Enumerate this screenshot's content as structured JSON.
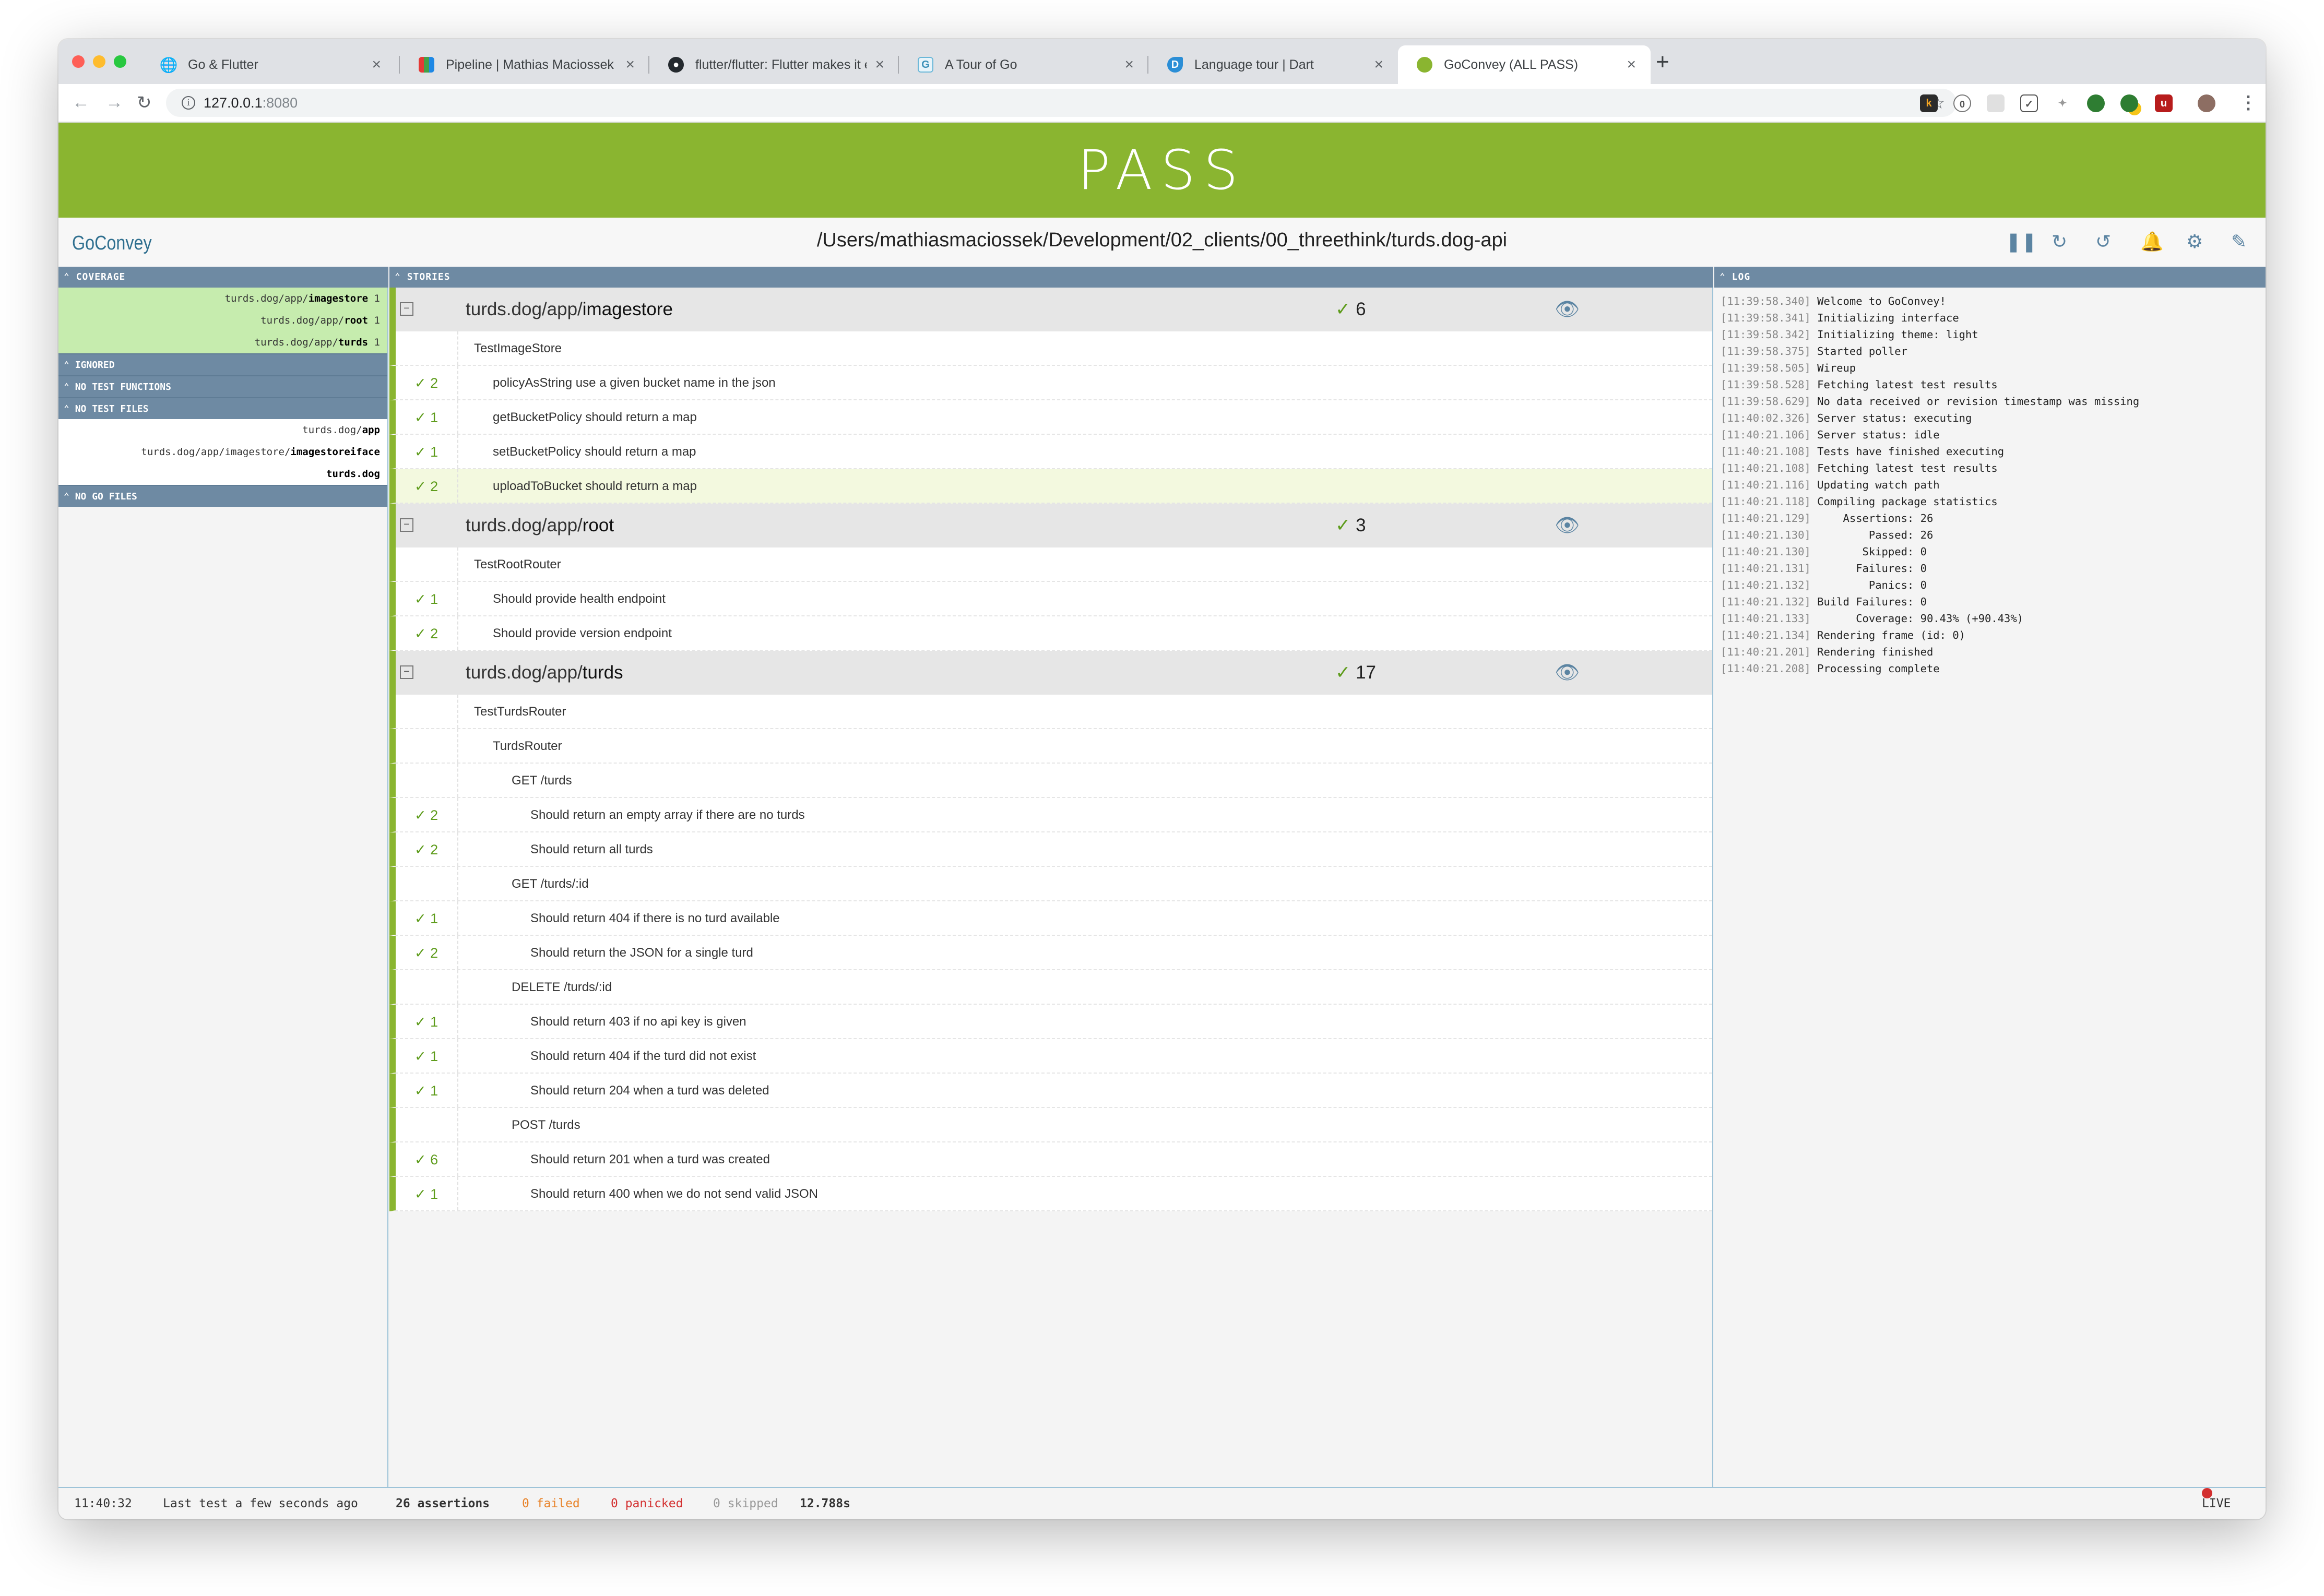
{
  "browser": {
    "tabs": [
      {
        "title": "Go & Flutter",
        "icon": "globe-icon"
      },
      {
        "title": "Pipeline | Mathias Maciossek CR",
        "icon": "pipeline-icon"
      },
      {
        "title": "flutter/flutter: Flutter makes it ea",
        "icon": "github-icon"
      },
      {
        "title": "A Tour of Go",
        "icon": "gopher-icon"
      },
      {
        "title": "Language tour | Dart",
        "icon": "dart-icon"
      },
      {
        "title": "GoConvey (ALL PASS)",
        "icon": "goconvey-icon"
      }
    ],
    "url_host": "127.0.0.1",
    "url_port": ":8080"
  },
  "banner": {
    "text": "PASS",
    "color": "#8ab530"
  },
  "header": {
    "brand": "GoConvey",
    "path": "/Users/mathiasmaciossek/Development/02_clients/00_threethink/turds.dog-api"
  },
  "coverage": {
    "title": "COVERAGE",
    "items": [
      {
        "prefix": "turds.dog/app/",
        "pkg": "imagestore",
        "pct": "1"
      },
      {
        "prefix": "turds.dog/app/",
        "pkg": "root",
        "pct": "1"
      },
      {
        "prefix": "turds.dog/app/",
        "pkg": "turds",
        "pct": "1"
      }
    ],
    "ignored": "IGNORED",
    "no_test_functions": "NO TEST FUNCTIONS",
    "no_test_files": "NO TEST FILES",
    "no_test_files_items": [
      {
        "prefix": "turds.dog/",
        "bold": "app"
      },
      {
        "prefix": "turds.dog/app/imagestore/",
        "bold": "imagestoreiface"
      },
      {
        "prefix": "",
        "bold": "turds.dog"
      }
    ],
    "no_go_files": "NO GO FILES"
  },
  "stories": {
    "title": "STORIES",
    "packages": [
      {
        "prefix": "turds.dog/app/",
        "name": "imagestore",
        "count": "6",
        "rows": [
          {
            "count": "",
            "text": "TestImageStore",
            "level": 0,
            "hl": false
          },
          {
            "count": "2",
            "text": "policyAsString use a given bucket name in the json",
            "level": 1,
            "hl": false
          },
          {
            "count": "1",
            "text": "getBucketPolicy should return a map",
            "level": 1,
            "hl": false
          },
          {
            "count": "1",
            "text": "setBucketPolicy should return a map",
            "level": 1,
            "hl": false
          },
          {
            "count": "2",
            "text": "uploadToBucket should return a map",
            "level": 1,
            "hl": true
          }
        ]
      },
      {
        "prefix": "turds.dog/app/",
        "name": "root",
        "count": "3",
        "rows": [
          {
            "count": "",
            "text": "TestRootRouter",
            "level": 0,
            "hl": false
          },
          {
            "count": "1",
            "text": "Should provide health endpoint",
            "level": 1,
            "hl": false
          },
          {
            "count": "2",
            "text": "Should provide version endpoint",
            "level": 1,
            "hl": false
          }
        ]
      },
      {
        "prefix": "turds.dog/app/",
        "name": "turds",
        "count": "17",
        "rows": [
          {
            "count": "",
            "text": "TestTurdsRouter",
            "level": 0,
            "hl": false
          },
          {
            "count": "",
            "text": "TurdsRouter",
            "level": 1,
            "hl": false
          },
          {
            "count": "",
            "text": "GET /turds",
            "level": 2,
            "hl": false
          },
          {
            "count": "2",
            "text": "Should return an empty array if there are no turds",
            "level": 3,
            "hl": false
          },
          {
            "count": "2",
            "text": "Should return all turds",
            "level": 3,
            "hl": false
          },
          {
            "count": "",
            "text": "GET /turds/:id",
            "level": 2,
            "hl": false
          },
          {
            "count": "1",
            "text": "Should return 404 if there is no turd available",
            "level": 3,
            "hl": false
          },
          {
            "count": "2",
            "text": "Should return the JSON for a single turd",
            "level": 3,
            "hl": false
          },
          {
            "count": "",
            "text": "DELETE /turds/:id",
            "level": 2,
            "hl": false
          },
          {
            "count": "1",
            "text": "Should return 403 if no api key is given",
            "level": 3,
            "hl": false
          },
          {
            "count": "1",
            "text": "Should return 404 if the turd did not exist",
            "level": 3,
            "hl": false
          },
          {
            "count": "1",
            "text": "Should return 204 when a turd was deleted",
            "level": 3,
            "hl": false
          },
          {
            "count": "",
            "text": "POST /turds",
            "level": 2,
            "hl": false
          },
          {
            "count": "6",
            "text": "Should return 201 when a turd was created",
            "level": 3,
            "hl": false
          },
          {
            "count": "1",
            "text": "Should return 400 when we do not send valid JSON",
            "level": 3,
            "hl": false
          }
        ]
      }
    ]
  },
  "log": {
    "title": "LOG",
    "lines": [
      {
        "ts": "[11:39:58.340]",
        "msg": "Welcome to GoConvey!"
      },
      {
        "ts": "[11:39:58.341]",
        "msg": "Initializing interface"
      },
      {
        "ts": "[11:39:58.342]",
        "msg": "Initializing theme: light"
      },
      {
        "ts": "[11:39:58.375]",
        "msg": "Started poller"
      },
      {
        "ts": "[11:39:58.505]",
        "msg": "Wireup"
      },
      {
        "ts": "[11:39:58.528]",
        "msg": "Fetching latest test results"
      },
      {
        "ts": "[11:39:58.629]",
        "msg": "No data received or revision timestamp was missing"
      },
      {
        "ts": "[11:40:02.326]",
        "msg": "Server status: executing"
      },
      {
        "ts": "[11:40:21.106]",
        "msg": "Server status: idle"
      },
      {
        "ts": "[11:40:21.108]",
        "msg": "Tests have finished executing"
      },
      {
        "ts": "[11:40:21.108]",
        "msg": "Fetching latest test results"
      },
      {
        "ts": "[11:40:21.116]",
        "msg": "Updating watch path"
      },
      {
        "ts": "[11:40:21.118]",
        "msg": "Compiling package statistics"
      },
      {
        "ts": "[11:40:21.129]",
        "msg": "    Assertions: 26"
      },
      {
        "ts": "[11:40:21.130]",
        "msg": "        Passed: 26"
      },
      {
        "ts": "[11:40:21.130]",
        "msg": "       Skipped: 0"
      },
      {
        "ts": "[11:40:21.131]",
        "msg": "      Failures: 0"
      },
      {
        "ts": "[11:40:21.132]",
        "msg": "        Panics: 0"
      },
      {
        "ts": "[11:40:21.132]",
        "msg": "Build Failures: 0"
      },
      {
        "ts": "[11:40:21.133]",
        "msg": "      Coverage: 90.43% (+90.43%)"
      },
      {
        "ts": "[11:40:21.134]",
        "msg": "Rendering frame (id: 0)"
      },
      {
        "ts": "[11:40:21.201]",
        "msg": "Rendering finished"
      },
      {
        "ts": "[11:40:21.208]",
        "msg": "Processing complete"
      }
    ]
  },
  "status": {
    "time": "11:40:32",
    "last_test": "Last test a few seconds ago",
    "assertions": "26 assertions",
    "failed": "0 failed",
    "panicked": "0 panicked",
    "skipped": "0 skipped",
    "duration": "12.788s",
    "live": "LIVE",
    "colors": {
      "failed": "#e8832a",
      "panicked": "#d32f2f",
      "skipped": "#999999",
      "live": "#d32f2f"
    }
  }
}
